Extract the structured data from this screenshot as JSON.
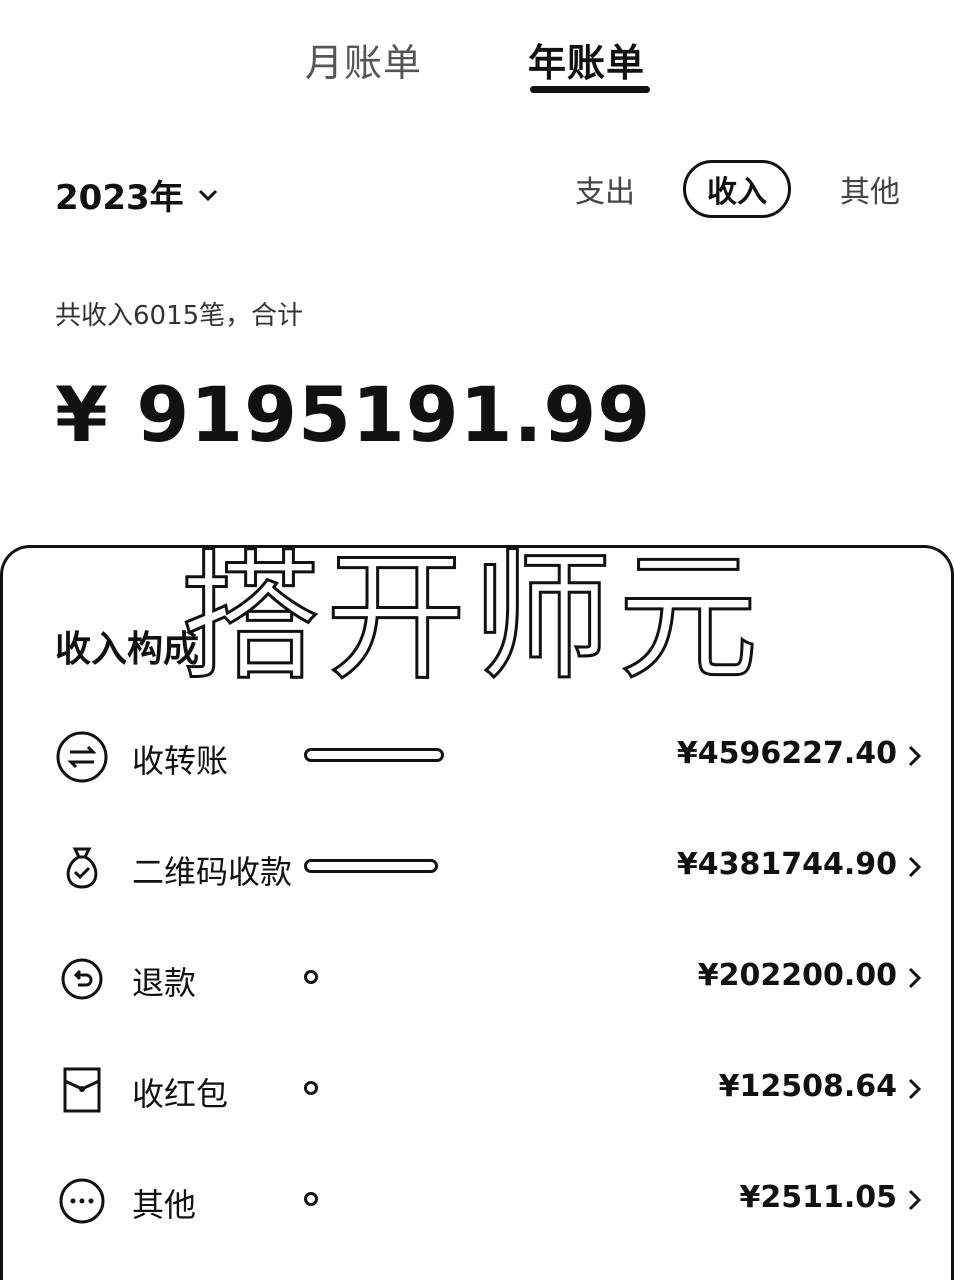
{
  "tabs": {
    "monthly": "月账单",
    "yearly": "年账单"
  },
  "filter": {
    "year": "2023年",
    "expense": "支出",
    "income": "收入",
    "other": "其他"
  },
  "summary": {
    "text": "共收入6015笔，合计",
    "total": "¥ 9195191.99"
  },
  "watermark": "搭开师元",
  "section_title": "收入构成",
  "items": [
    {
      "icon": "transfer-icon",
      "label": "收转账",
      "amount": "¥4596227.40",
      "share": 0.5
    },
    {
      "icon": "money-bag-icon",
      "label": "二维码收款",
      "amount": "¥4381744.90",
      "share": 0.48
    },
    {
      "icon": "refund-icon",
      "label": "退款",
      "amount": "¥202200.00",
      "share": 0.02
    },
    {
      "icon": "red-packet-icon",
      "label": "收红包",
      "amount": "¥12508.64",
      "share": 0.001
    },
    {
      "icon": "more-icon",
      "label": "其他",
      "amount": "¥2511.05",
      "share": 0.0003
    }
  ]
}
